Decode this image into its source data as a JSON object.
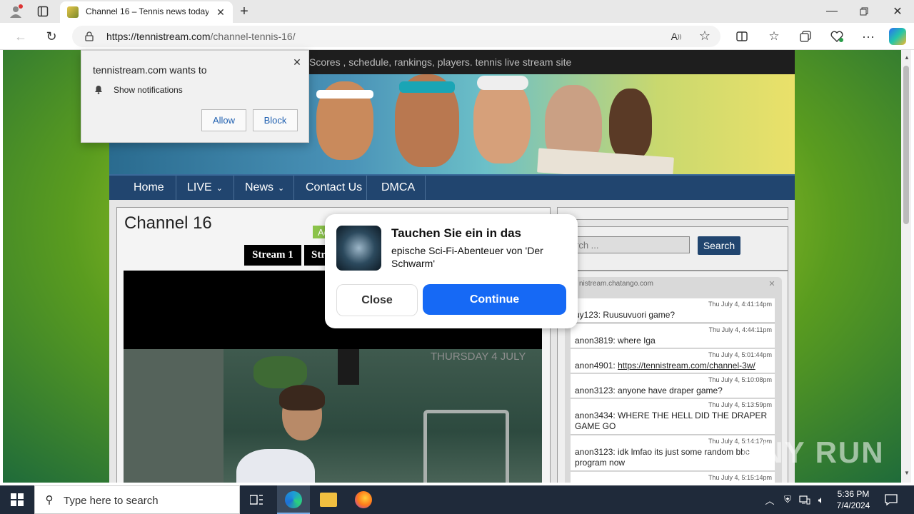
{
  "browser": {
    "tab_title": "Channel 16 – Tennis news today, ",
    "url": "https://tennistream.com/channel-tennis-16/",
    "url_host": "https://tennistream.com",
    "url_path": "/channel-tennis-16/"
  },
  "site": {
    "tagline": "Scores , schedule, rankings, players. tennis live stream site",
    "nav": [
      {
        "label": "Home"
      },
      {
        "label": "LIVE"
      },
      {
        "label": "News"
      },
      {
        "label": "Contact Us"
      },
      {
        "label": "DMCA"
      }
    ],
    "page_title": "Channel 16",
    "stream_tabs": [
      "Stream 1",
      "Str"
    ],
    "search_placeholder": "rch ...",
    "search_button": "Search",
    "chat_host": "nistream.chatango.com",
    "chat_messages": [
      {
        "time": "Thu July 4, 4:41:14pm",
        "text": "uy123: Ruusuvuori game?"
      },
      {
        "time": "Thu July 4, 4:44:11pm",
        "text": "anon3819: where Iga"
      },
      {
        "time": "Thu July 4, 5:01:44pm",
        "text_prefix": "anon4901: ",
        "link": "https://tennistream.com/channel-3w/"
      },
      {
        "time": "Thu July 4, 5:10:08pm",
        "text": "anon3123: anyone have draper game?"
      },
      {
        "time": "Thu July 4, 5:13:59pm",
        "text": "anon3434: WHERE THE HELL DID THE DRAPER GAME GO"
      },
      {
        "time": "Thu July 4, 5:14:17pm",
        "text": "anon3123: idk lmfao its just some random bbc program now"
      },
      {
        "time": "Thu July 4, 5:15:14pm",
        "text": ""
      }
    ],
    "video_overlay_text": "THURSDAY 4 JULY"
  },
  "notification": {
    "title": "tennistream.com wants to",
    "item": "Show notifications",
    "allow": "Allow",
    "block": "Block"
  },
  "ad": {
    "badge": "Ad",
    "title": "Tauchen Sie ein in das",
    "body": "epische Sci-Fi-Abenteuer von 'Der Schwarm'",
    "close": "Close",
    "continue": "Continue"
  },
  "taskbar": {
    "search_placeholder": "Type here to search",
    "time": "5:36 PM",
    "date": "7/4/2024"
  },
  "watermark": "ANY RUN"
}
